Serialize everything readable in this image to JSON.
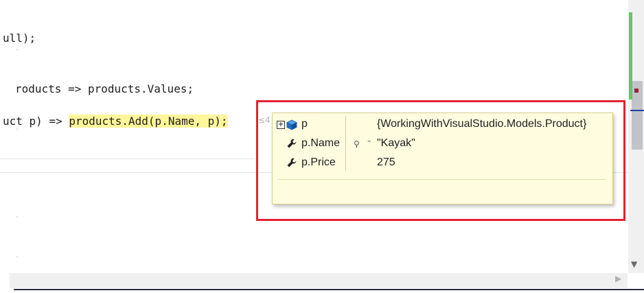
{
  "editor": {
    "lines": [
      "ull);",
      "roducts => products.Values;",
      "uct p) => ",
      "products.Add(p.Name, p);"
    ],
    "inline_hint": "≤4"
  },
  "datatip": {
    "rows": [
      {
        "name": "p",
        "value": "{WorkingWithVisualStudio.Models.Product}",
        "icon": "object-icon",
        "expandable": true
      },
      {
        "name": "p.Name",
        "value": "\"Kayak\"",
        "icon": "wrench-icon",
        "has_visualizer": true
      },
      {
        "name": "p.Price",
        "value": "275",
        "icon": "wrench-icon"
      }
    ],
    "expand_glyph": "+",
    "visualizer_glyph": "⚲",
    "dash_glyph": "-"
  },
  "colors": {
    "highlight": "#fff59a",
    "annotation_red": "#e2222f",
    "changed_bar": "#5fca5f"
  }
}
